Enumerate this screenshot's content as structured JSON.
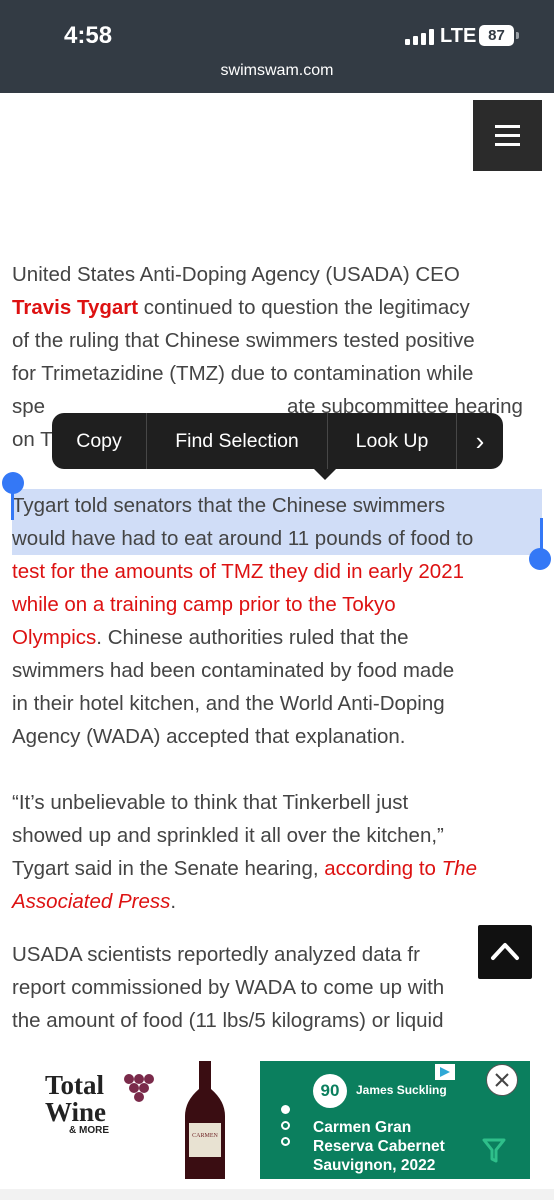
{
  "status_bar": {
    "time": "4:58",
    "network": "LTE",
    "battery": "87"
  },
  "browser": {
    "url": "swimswam.com"
  },
  "article": {
    "p1": {
      "lead": "United States Anti-Doping Agency (USADA) CEO",
      "name": "Travis Tygart",
      "rest_line1": "continued to question the legitimacy",
      "line2": "of the ruling that Chinese swimmers tested positive",
      "line3": "for Trimetazidine (TMZ) due to contamination while",
      "line4_visible": "spe",
      "line4_tail": "ate subcommittee hearing",
      "line5_visible": "on T"
    },
    "p2": {
      "line1": "Tygart told senators that the Chinese swimmers",
      "line2": "would have had to eat around 11 pounds of food to",
      "link_line3": "test for the amounts of TMZ they did in early 2021",
      "link_line4": "while on a training camp prior to the Tokyo",
      "link_line5": "Olympics",
      "rest_line5": ". Chinese authorities ruled that the",
      "line6": "swimmers had been contaminated by food made",
      "line7": "in their hotel kitchen, and the World Anti-Doping",
      "line8": "Agency (WADA) accepted that explanation."
    },
    "p3": {
      "line1": "“It’s unbelievable to think that Tinkerbell just",
      "line2": "showed up and sprinkled it all over the kitchen,”",
      "line3_text": "Tygart said in the Senate hearing,",
      "line3_link": "according to",
      "line3_link_italic": "The",
      "line4_link_italic": "Associated Press",
      "line4_end": "."
    },
    "p4": {
      "line1": "USADA scientists reportedly analyzed data fr",
      "line2": "report commissioned by WADA to come up with",
      "line3": "the amount of food (11 lbs/5 kilograms) or liquid"
    }
  },
  "context_menu": {
    "items": [
      "Copy",
      "Find Selection",
      "Look Up"
    ],
    "more_label": "›"
  },
  "ad": {
    "brand": "Total",
    "brand2": "Wine",
    "brand_sub": "& MORE",
    "score": "90",
    "critic": "James Suckling",
    "wine_line1": "Carmen Gran",
    "wine_line2": "Reserva Cabernet",
    "wine_line3": "Sauvignon, 2022",
    "bottle_label": "CARMEN",
    "accent_color": "#0b7f5e"
  },
  "colors": {
    "link": "#dd1111",
    "selection": "#d0ddf7",
    "handle": "#3478f6",
    "status_bar": "#333b44"
  }
}
